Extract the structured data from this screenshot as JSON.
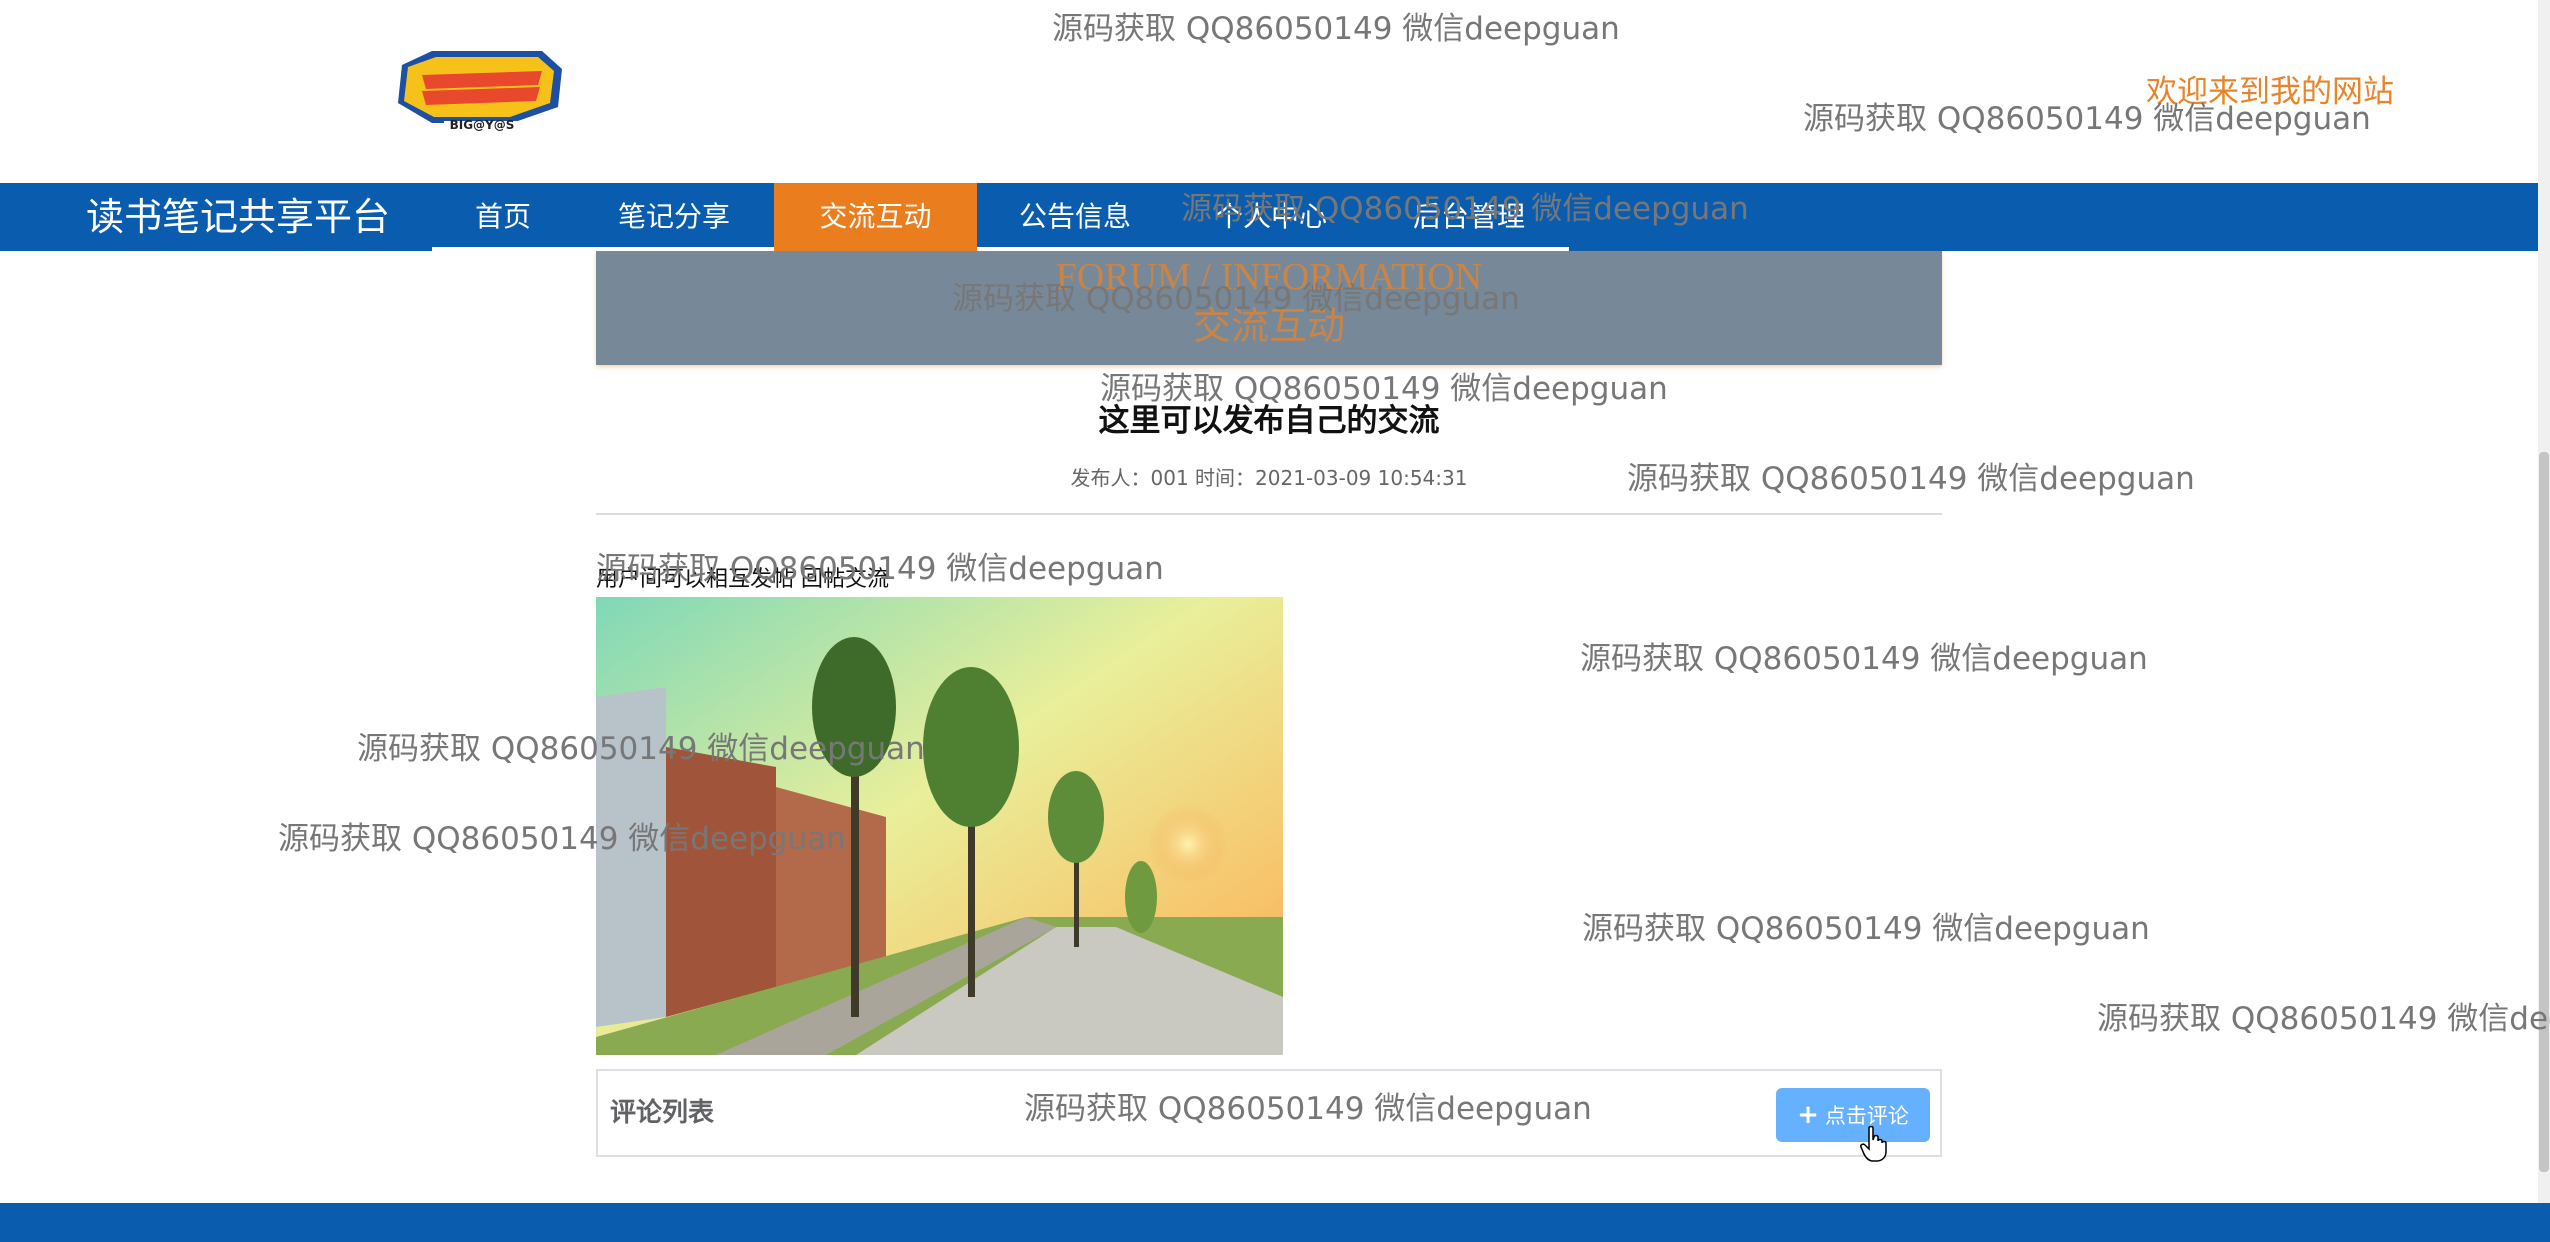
{
  "header": {
    "logo_text": "BIG@Y@S",
    "welcome": "欢迎来到我的网站"
  },
  "nav": {
    "site_title": "读书笔记共享平台",
    "items": [
      {
        "label": "首页"
      },
      {
        "label": "笔记分享"
      },
      {
        "label": "交流互动"
      },
      {
        "label": "公告信息"
      },
      {
        "label": "个人中心"
      },
      {
        "label": "后台管理"
      }
    ],
    "active_item": "交流互动"
  },
  "banner": {
    "title_en": "FORUM / INFORMATION",
    "title_cn": "交流互动"
  },
  "post": {
    "title": "这里可以发布自己的交流",
    "meta": "发布人：001 时间：2021-03-09 10:54:31",
    "content": "用户间可以相互发帖 回帖交流"
  },
  "comments": {
    "list_label": "评论列表",
    "button_label": "点击评论",
    "button_icon": "plus-icon"
  },
  "watermark": {
    "text": "源码获取 QQ86050149 微信deepguan",
    "truncated_text": "源码获取 QQ86050149 微信deep"
  },
  "colors": {
    "nav_bg": "#0a5cae",
    "nav_active": "#ea7d1d",
    "accent_orange": "#e6852b",
    "banner_bg": "#778899",
    "button_blue": "#66b1ff"
  }
}
